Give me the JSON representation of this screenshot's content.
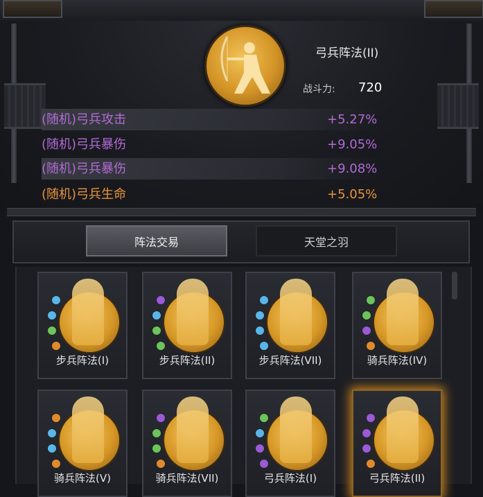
{
  "formation": {
    "title": "弓兵阵法(II)",
    "power_label": "战斗力:",
    "power_value": "720",
    "icon": "archer-emblem-icon"
  },
  "stats": [
    {
      "name": "(随机)弓兵攻击",
      "value": "+5.27%",
      "color": "#b26bd6"
    },
    {
      "name": "(随机)弓兵暴伤",
      "value": "+9.05%",
      "color": "#b26bd6"
    },
    {
      "name": "(随机)弓兵暴伤",
      "value": "+9.08%",
      "color": "#b26bd6"
    },
    {
      "name": "(随机)弓兵生命",
      "value": "+5.05%",
      "color": "#e8953a"
    }
  ],
  "tabs": [
    {
      "label": "阵法交易",
      "active": true
    },
    {
      "label": "天堂之羽",
      "active": false
    }
  ],
  "cards": [
    {
      "label": "步兵阵法(I)",
      "icon": "infantry-icon"
    },
    {
      "label": "步兵阵法(II)",
      "icon": "infantry-icon"
    },
    {
      "label": "步兵阵法(VII)",
      "icon": "infantry-icon"
    },
    {
      "label": "骑兵阵法(IV)",
      "icon": "cavalry-icon"
    },
    {
      "label": "骑兵阵法(V)",
      "icon": "cavalry-icon"
    },
    {
      "label": "骑兵阵法(VII)",
      "icon": "cavalry-icon"
    },
    {
      "label": "弓兵阵法(I)",
      "icon": "archer-icon"
    },
    {
      "label": "弓兵阵法(II)",
      "icon": "archer-icon",
      "selected": true
    }
  ]
}
